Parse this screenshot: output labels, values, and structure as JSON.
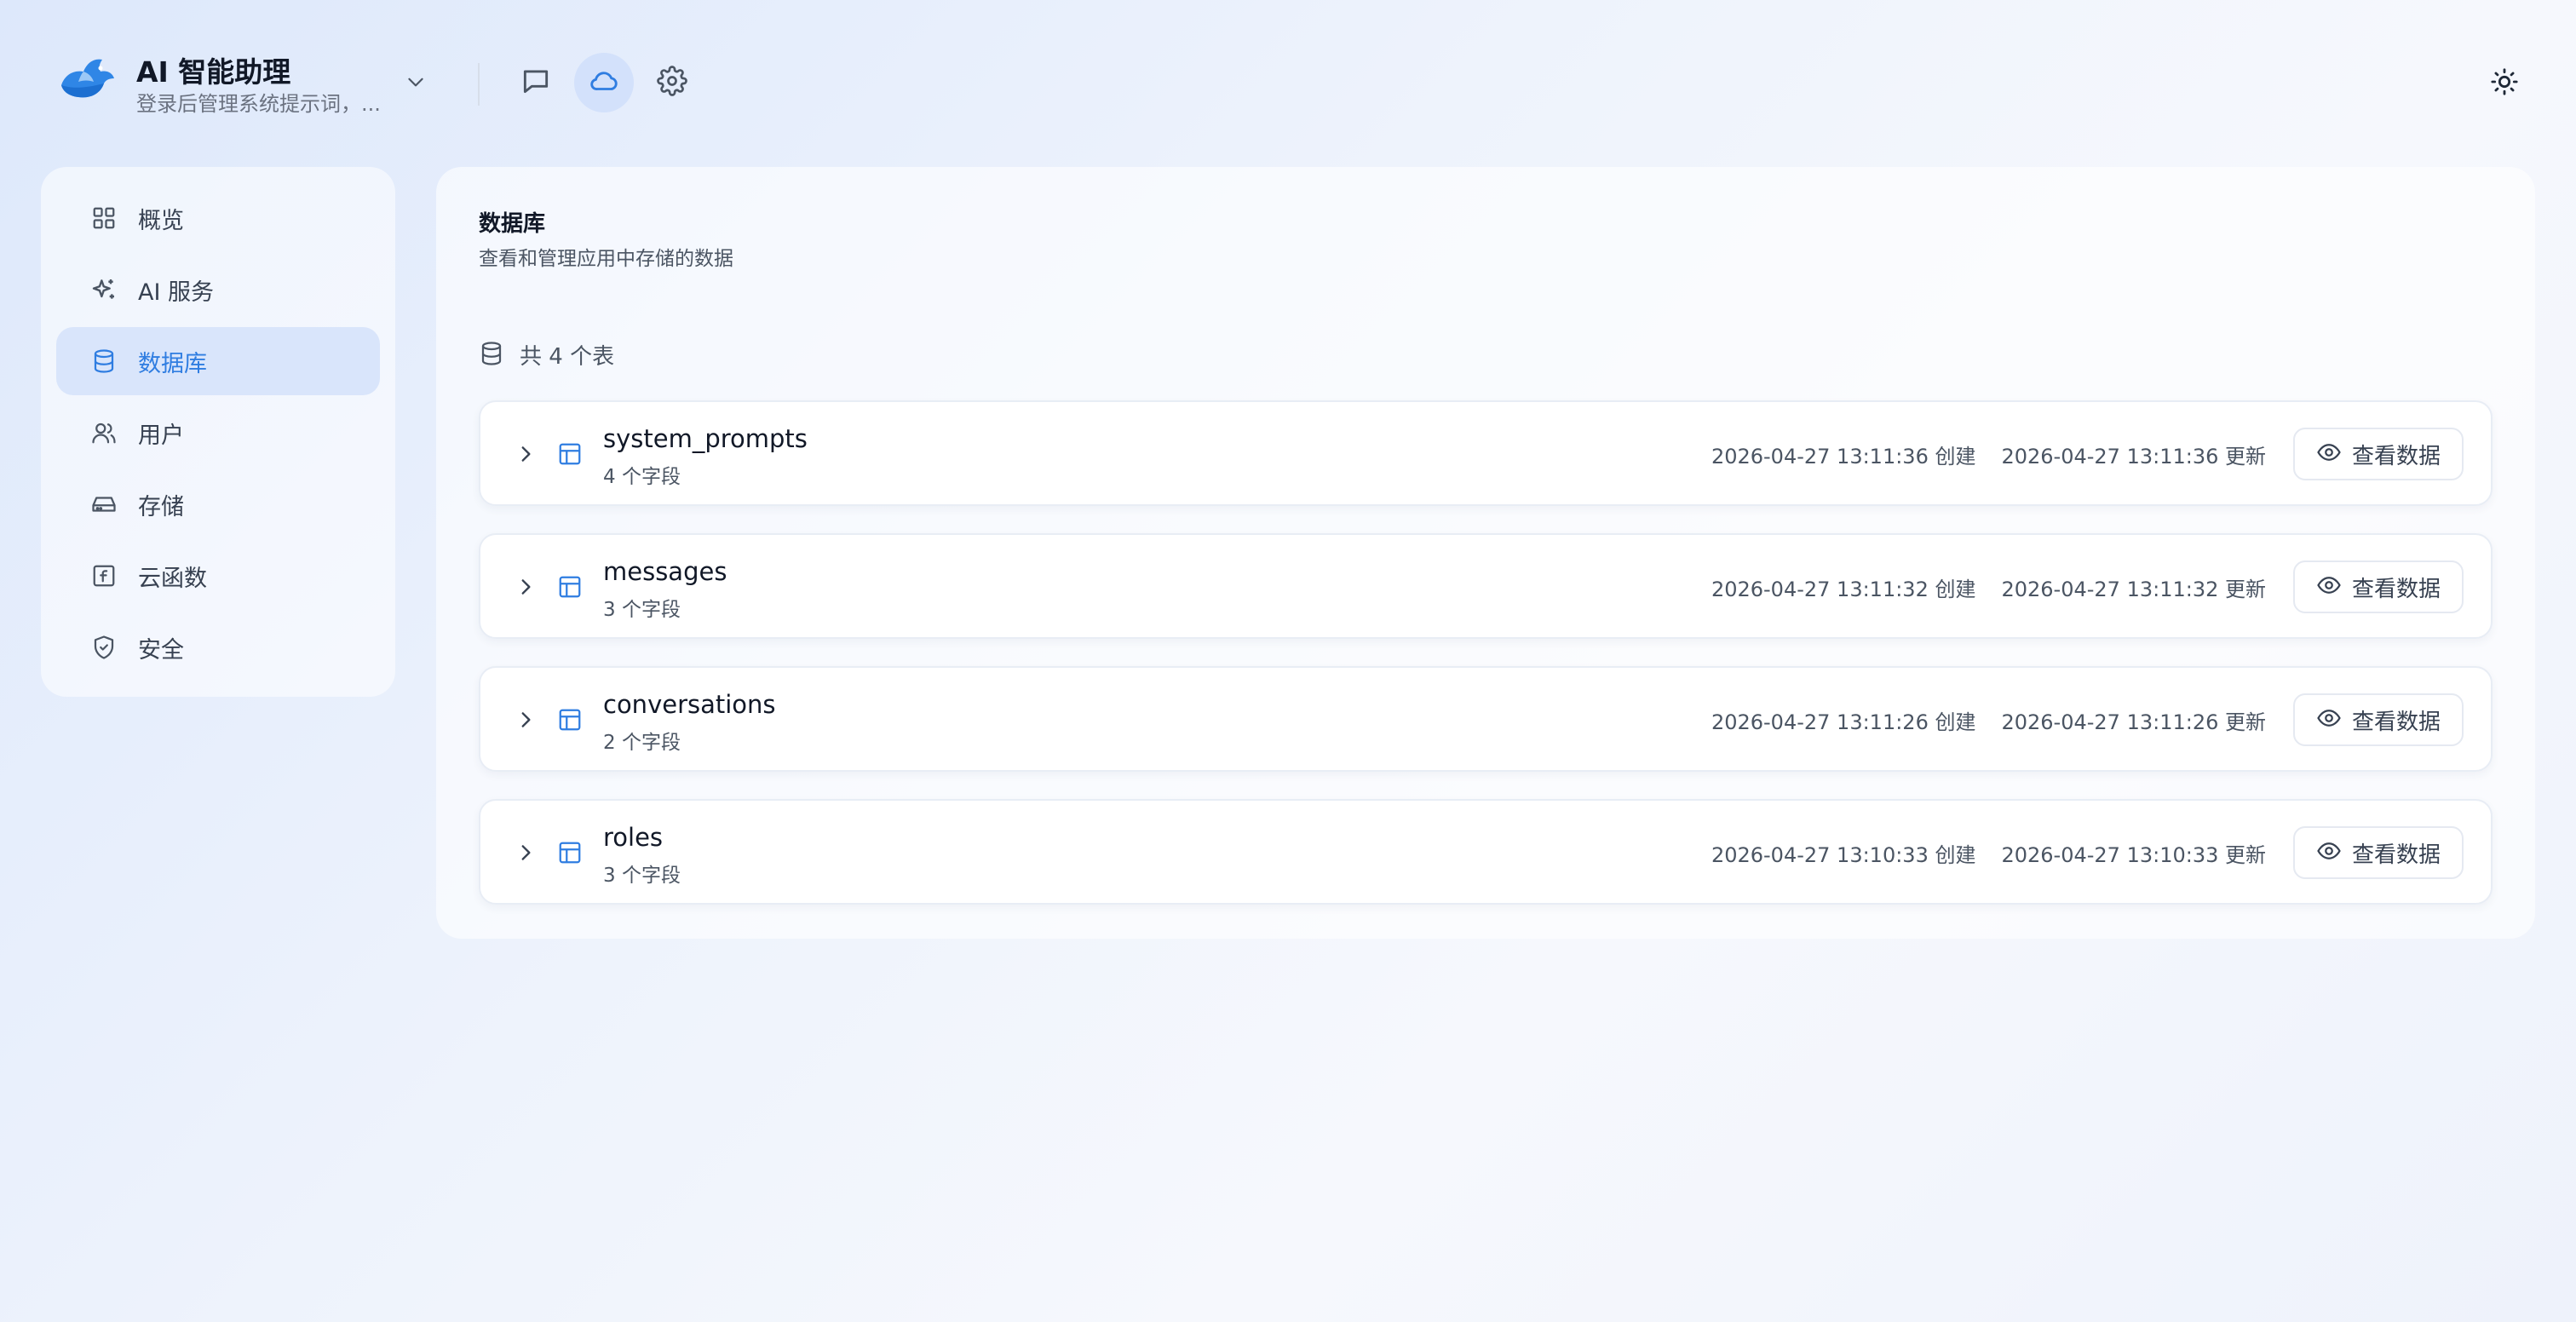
{
  "header": {
    "app_title": "AI 智能助理",
    "app_subtitle": "登录后管理系统提示词，...",
    "icons": [
      "chat-icon",
      "cloud-icon",
      "settings-icon",
      "sun-icon"
    ],
    "accent_color": "#2f7de1"
  },
  "sidebar": {
    "items": [
      {
        "label": "概览",
        "icon": "grid-icon"
      },
      {
        "label": "AI 服务",
        "icon": "sparkle-icon"
      },
      {
        "label": "数据库",
        "icon": "database-icon"
      },
      {
        "label": "用户",
        "icon": "users-icon"
      },
      {
        "label": "存储",
        "icon": "hard-drive-icon"
      },
      {
        "label": "云函数",
        "icon": "function-icon"
      },
      {
        "label": "安全",
        "icon": "shield-icon"
      }
    ],
    "active_index": 2
  },
  "main": {
    "title": "数据库",
    "description": "查看和管理应用中存储的数据",
    "table_count_text": "共 4 个表",
    "view_button_label": "查看数据",
    "tables": [
      {
        "name": "system_prompts",
        "fields": "4 个字段",
        "created": "2026-04-27 13:11:36 创建",
        "updated": "2026-04-27 13:11:36 更新"
      },
      {
        "name": "messages",
        "fields": "3 个字段",
        "created": "2026-04-27 13:11:32 创建",
        "updated": "2026-04-27 13:11:32 更新"
      },
      {
        "name": "conversations",
        "fields": "2 个字段",
        "created": "2026-04-27 13:11:26 创建",
        "updated": "2026-04-27 13:11:26 更新"
      },
      {
        "name": "roles",
        "fields": "3 个字段",
        "created": "2026-04-27 13:10:33 创建",
        "updated": "2026-04-27 13:10:33 更新"
      }
    ]
  }
}
